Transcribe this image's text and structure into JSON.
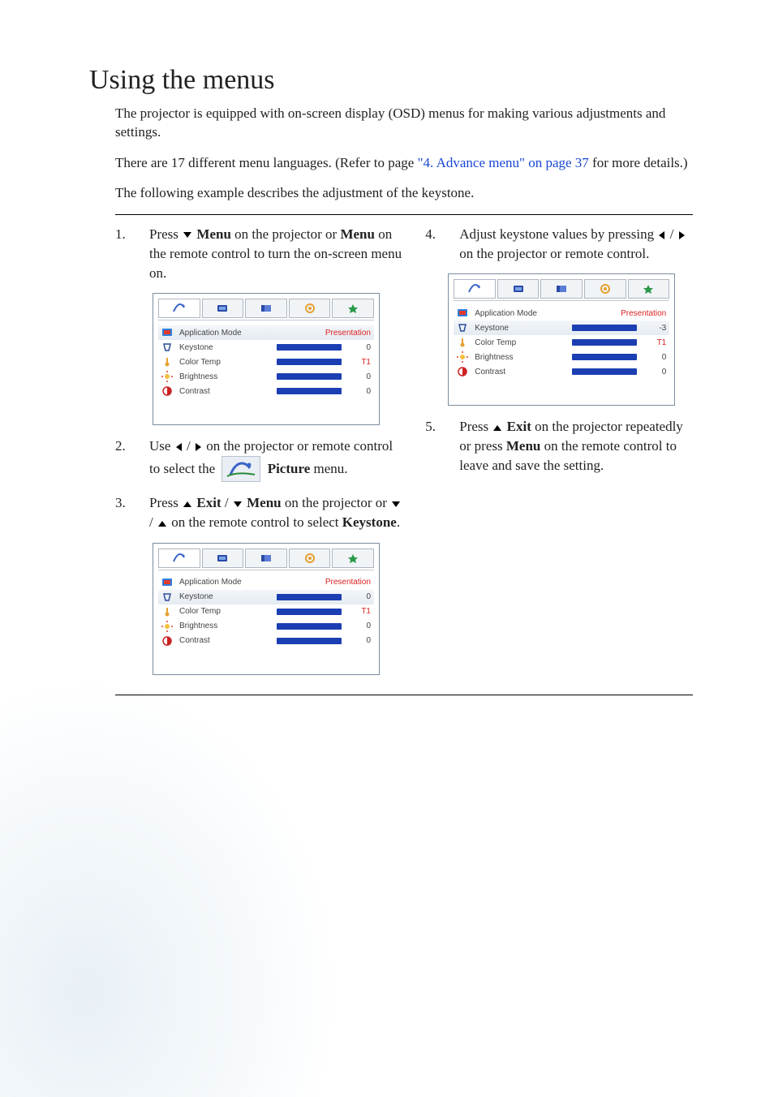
{
  "title": "Using the menus",
  "intro": {
    "p1": "The projector is equipped with on-screen display (OSD) menus for making various adjustments and settings.",
    "p2a": "There are 17 different menu languages. (Refer to page ",
    "p2_link": "\"4. Advance menu\" on page 37",
    "p2b": " for more details.)",
    "p3": "The following example describes the adjustment of the keystone."
  },
  "steps_left": [
    {
      "num": "1.",
      "pre": "Press ",
      "arrows": [
        "down"
      ],
      "mid": " ",
      "bold1": "Menu",
      "post1": " on the projector or ",
      "bold2": "Menu",
      "post2": " on the remote control to turn the on-screen menu on."
    },
    {
      "num": "2.",
      "pre": "Use ",
      "arrows": [
        "left",
        "right"
      ],
      "sep": " /  ",
      "post_pre": " on the projector or remote control to select the ",
      "icon": true,
      "bold1": "Picture",
      "post1": " menu."
    },
    {
      "num": "3.",
      "pre": "Press ",
      "arrows1": [
        "up"
      ],
      "bold1": " Exit",
      "mid1": " / ",
      "arrows2": [
        "down"
      ],
      "bold2": " Menu",
      "post1": " on the projector or ",
      "arrows3": [
        "down"
      ],
      "mid2": " / ",
      "arrows4": [
        "up"
      ],
      "post2": " on the remote control to select ",
      "bold3": "Keystone",
      "post3": "."
    }
  ],
  "steps_right": [
    {
      "num": "4.",
      "pre": "Adjust keystone values by pressing ",
      "arrows": [
        "left",
        "right"
      ],
      "sep": " /  ",
      "post": " on the projector or remote control."
    },
    {
      "num": "5.",
      "pre": "Press ",
      "arrows": [
        "up"
      ],
      "bold1": " Exit",
      "post1": " on the projector repeatedly or press ",
      "bold2": "Menu",
      "post2": " on the remote control to leave and save the setting."
    }
  ],
  "osd_a": {
    "rows": [
      {
        "icon": "app",
        "label": "Application Mode",
        "value": "Presentation",
        "value_red": true,
        "selected": true,
        "bar": false
      },
      {
        "icon": "key",
        "label": "Keystone",
        "value": "0",
        "bar": true
      },
      {
        "icon": "temp",
        "label": "Color Temp",
        "value": "T1",
        "value_red": true,
        "bar": true
      },
      {
        "icon": "bri",
        "label": "Brightness",
        "value": "0",
        "bar": true
      },
      {
        "icon": "con",
        "label": "Contrast",
        "value": "0",
        "bar": true
      }
    ]
  },
  "osd_b": {
    "rows": [
      {
        "icon": "app",
        "label": "Application Mode",
        "value": "Presentation",
        "value_red": true,
        "bar": false
      },
      {
        "icon": "key",
        "label": "Keystone",
        "value": "0",
        "selected": true,
        "bar": true
      },
      {
        "icon": "temp",
        "label": "Color Temp",
        "value": "T1",
        "value_red": true,
        "bar": true
      },
      {
        "icon": "bri",
        "label": "Brightness",
        "value": "0",
        "bar": true
      },
      {
        "icon": "con",
        "label": "Contrast",
        "value": "0",
        "bar": true
      }
    ]
  },
  "osd_c": {
    "rows": [
      {
        "icon": "app",
        "label": "Application Mode",
        "value": "Presentation",
        "value_red": true,
        "bar": false
      },
      {
        "icon": "key",
        "label": "Keystone",
        "value": "-3",
        "selected": true,
        "bar": true
      },
      {
        "icon": "temp",
        "label": "Color Temp",
        "value": "T1",
        "value_red": true,
        "bar": true
      },
      {
        "icon": "bri",
        "label": "Brightness",
        "value": "0",
        "bar": true
      },
      {
        "icon": "con",
        "label": "Contrast",
        "value": "0",
        "bar": true
      }
    ]
  }
}
